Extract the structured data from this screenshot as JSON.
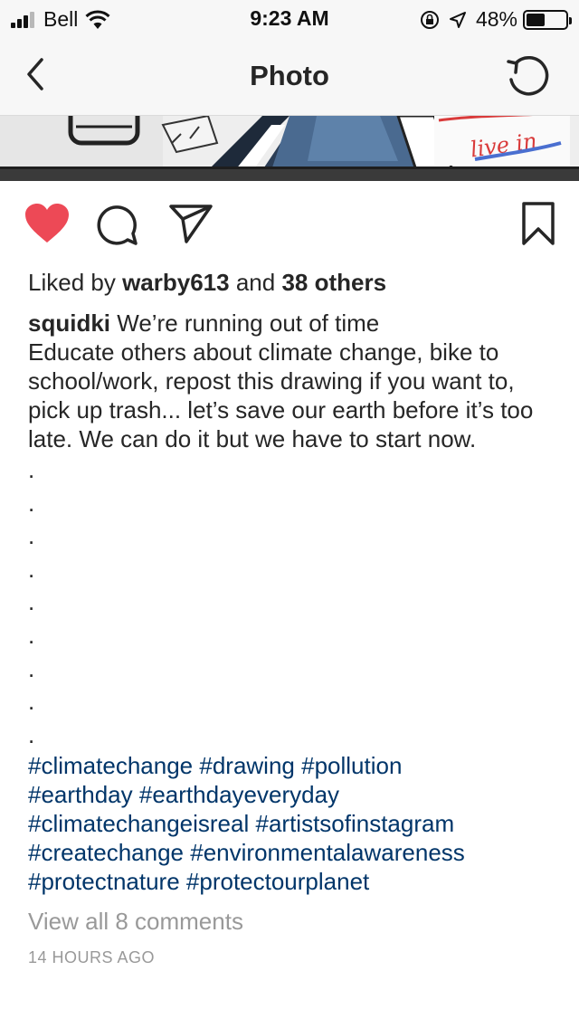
{
  "status_bar": {
    "carrier": "Bell",
    "time": "9:23 AM",
    "battery_percent": "48%",
    "battery_level": 0.48,
    "signal_bars_active": 3,
    "signal_bars_total": 4
  },
  "nav": {
    "title": "Photo",
    "back_icon": "chevron-left-icon",
    "refresh_icon": "refresh-icon"
  },
  "photo": {
    "handwritten_text": "live in"
  },
  "actions": {
    "like_icon": "heart-icon",
    "like_color": "#ed4956",
    "comment_icon": "comment-icon",
    "share_icon": "send-icon",
    "save_icon": "bookmark-icon"
  },
  "post": {
    "likes_prefix": "Liked by",
    "liked_by_user": "warby613",
    "likes_connector": "and",
    "likes_others": "38 others",
    "username": "squidki",
    "caption_first_line": "We’re running out of time",
    "caption_body": "Educate others about climate change, bike to school/work, repost this drawing if you want to, pick up trash... let’s save our earth before it’s too late. We can do it but we have to start now.",
    "dots": [
      ".",
      ".",
      ".",
      ".",
      ".",
      ".",
      ".",
      ".",
      "."
    ],
    "hashtags": [
      "#climatechange",
      "#drawing",
      "#pollution",
      "#earthday",
      "#earthdayeveryday",
      "#climatechangeisreal",
      "#artistsofinstagram",
      "#createchange",
      "#environmentalawareness",
      "#protectnature",
      "#protectourplanet"
    ],
    "view_comments": "View all 8 comments",
    "timestamp": "14 HOURS AGO"
  },
  "colors": {
    "hashtag": "#003569",
    "secondary_text": "#999999",
    "bar_background": "#f7f7f7"
  }
}
